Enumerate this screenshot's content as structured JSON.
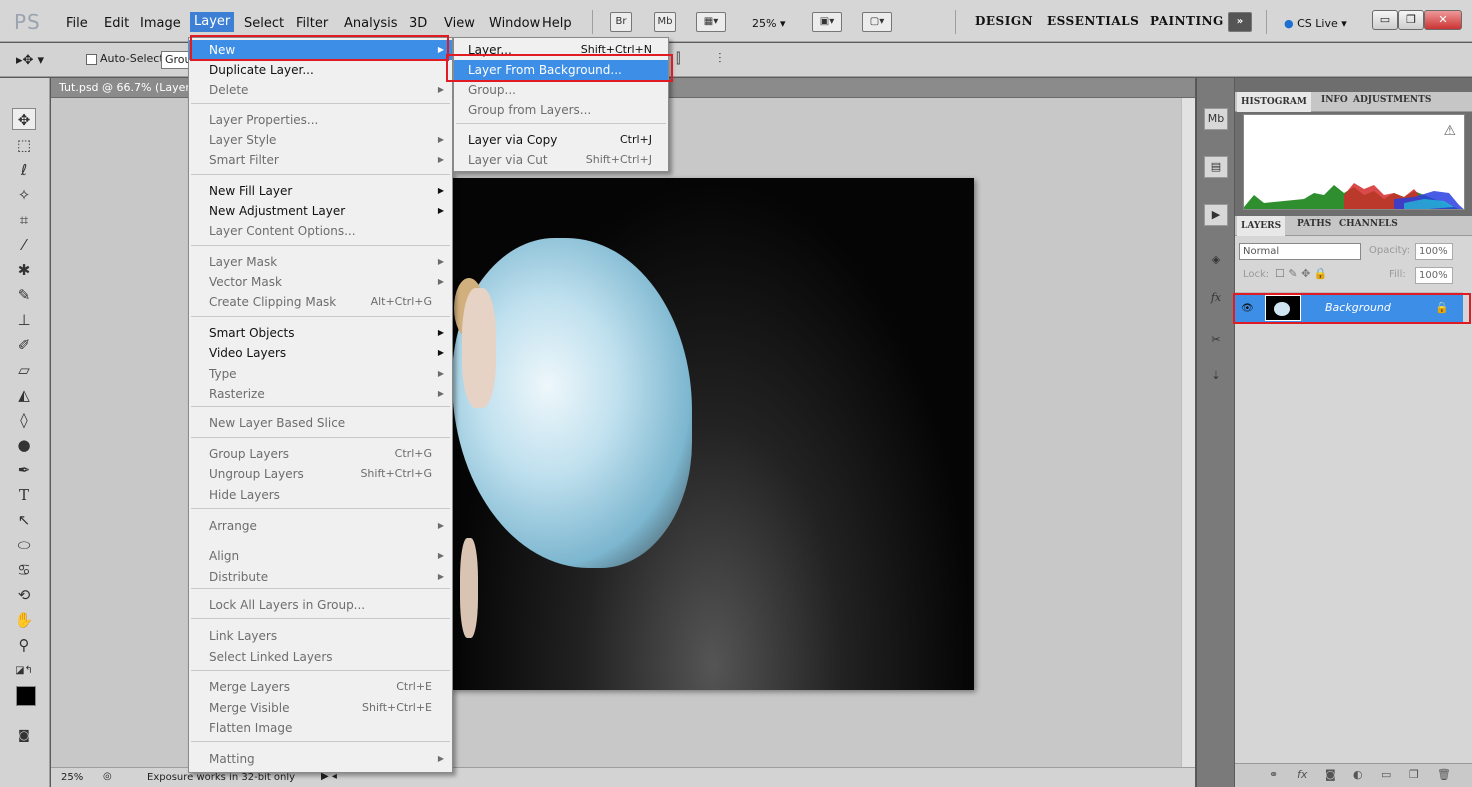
{
  "app": {
    "logo": "PS",
    "menus": [
      "File",
      "Edit",
      "Image",
      "Layer",
      "Select",
      "Filter",
      "Analysis",
      "3D",
      "View",
      "Window",
      "Help"
    ],
    "bridge_btn": "Br",
    "minibridge_btn": "Mb",
    "zoom_dropdown": "25% ▾",
    "workspaces": [
      "DESIGN",
      "ESSENTIALS",
      "PAINTING"
    ],
    "workspace_more": "»",
    "cs_live": "CS Live ▾"
  },
  "options_bar": {
    "tool_icon": "move-tool-icon",
    "auto_select_label": "Auto-Select:",
    "auto_select_value": "Group"
  },
  "document": {
    "tab_title": "Tut.psd @ 66.7% (Layer",
    "zoom": "25%",
    "status": "Exposure works in 32-bit only"
  },
  "layer_menu": {
    "items": [
      {
        "label": "New",
        "shortcut": "",
        "submenu": true,
        "disabled": false,
        "highlight": true
      },
      {
        "label": "Duplicate Layer...",
        "shortcut": "",
        "submenu": false,
        "disabled": false
      },
      {
        "label": "Delete",
        "shortcut": "",
        "submenu": true,
        "disabled": true
      },
      {
        "label": "Layer Properties...",
        "shortcut": "",
        "submenu": false,
        "disabled": true
      },
      {
        "label": "Layer Style",
        "shortcut": "",
        "submenu": true,
        "disabled": true
      },
      {
        "label": "Smart Filter",
        "shortcut": "",
        "submenu": true,
        "disabled": true
      },
      {
        "label": "New Fill Layer",
        "shortcut": "",
        "submenu": true,
        "disabled": false
      },
      {
        "label": "New Adjustment Layer",
        "shortcut": "",
        "submenu": true,
        "disabled": false
      },
      {
        "label": "Layer Content Options...",
        "shortcut": "",
        "submenu": false,
        "disabled": true
      },
      {
        "label": "Layer Mask",
        "shortcut": "",
        "submenu": true,
        "disabled": true
      },
      {
        "label": "Vector Mask",
        "shortcut": "",
        "submenu": true,
        "disabled": true
      },
      {
        "label": "Create Clipping Mask",
        "shortcut": "Alt+Ctrl+G",
        "submenu": false,
        "disabled": true
      },
      {
        "label": "Smart Objects",
        "shortcut": "",
        "submenu": true,
        "disabled": false
      },
      {
        "label": "Video Layers",
        "shortcut": "",
        "submenu": true,
        "disabled": false
      },
      {
        "label": "Type",
        "shortcut": "",
        "submenu": true,
        "disabled": true
      },
      {
        "label": "Rasterize",
        "shortcut": "",
        "submenu": true,
        "disabled": true
      },
      {
        "label": "New Layer Based Slice",
        "shortcut": "",
        "submenu": false,
        "disabled": true
      },
      {
        "label": "Group Layers",
        "shortcut": "Ctrl+G",
        "submenu": false,
        "disabled": true
      },
      {
        "label": "Ungroup Layers",
        "shortcut": "Shift+Ctrl+G",
        "submenu": false,
        "disabled": true
      },
      {
        "label": "Hide Layers",
        "shortcut": "",
        "submenu": false,
        "disabled": true
      },
      {
        "label": "Arrange",
        "shortcut": "",
        "submenu": true,
        "disabled": true
      },
      {
        "label": "Align",
        "shortcut": "",
        "submenu": true,
        "disabled": true
      },
      {
        "label": "Distribute",
        "shortcut": "",
        "submenu": true,
        "disabled": true
      },
      {
        "label": "Lock All Layers in Group...",
        "shortcut": "",
        "submenu": false,
        "disabled": true
      },
      {
        "label": "Link Layers",
        "shortcut": "",
        "submenu": false,
        "disabled": true
      },
      {
        "label": "Select Linked Layers",
        "shortcut": "",
        "submenu": false,
        "disabled": true
      },
      {
        "label": "Merge Layers",
        "shortcut": "Ctrl+E",
        "submenu": false,
        "disabled": true
      },
      {
        "label": "Merge Visible",
        "shortcut": "Shift+Ctrl+E",
        "submenu": false,
        "disabled": true
      },
      {
        "label": "Flatten Image",
        "shortcut": "",
        "submenu": false,
        "disabled": true
      },
      {
        "label": "Matting",
        "shortcut": "",
        "submenu": true,
        "disabled": true
      }
    ]
  },
  "new_submenu": {
    "items": [
      {
        "label": "Layer...",
        "shortcut": "Shift+Ctrl+N",
        "disabled": false
      },
      {
        "label": "Layer From Background...",
        "shortcut": "",
        "disabled": false,
        "highlight": true
      },
      {
        "label": "Group...",
        "shortcut": "",
        "disabled": true
      },
      {
        "label": "Group from Layers...",
        "shortcut": "",
        "disabled": true
      },
      {
        "label": "Layer via Copy",
        "shortcut": "Ctrl+J",
        "disabled": false
      },
      {
        "label": "Layer via Cut",
        "shortcut": "Shift+Ctrl+J",
        "disabled": true
      }
    ]
  },
  "panels": {
    "top_tabs": [
      "HISTOGRAM",
      "INFO",
      "ADJUSTMENTS"
    ],
    "layer_tabs": [
      "LAYERS",
      "PATHS",
      "CHANNELS"
    ],
    "blend_mode": "Normal",
    "opacity_label": "Opacity:",
    "opacity_value": "100%",
    "lock_label": "Lock:",
    "fill_label": "Fill:",
    "fill_value": "100%",
    "layer_name": "Background"
  },
  "colors": {
    "highlight": "#3d8ee6",
    "annotation": "#e01b24"
  }
}
